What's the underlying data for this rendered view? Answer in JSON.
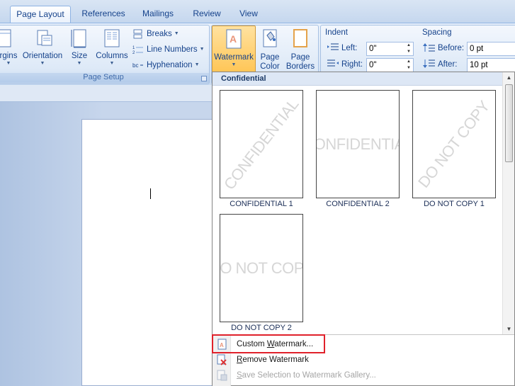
{
  "tabs": [
    {
      "label": "Page Layout",
      "active": true
    },
    {
      "label": "References",
      "active": false
    },
    {
      "label": "Mailings",
      "active": false
    },
    {
      "label": "Review",
      "active": false
    },
    {
      "label": "View",
      "active": false
    }
  ],
  "ribbon": {
    "page_setup": {
      "label": "Page Setup",
      "margins": "rgins",
      "orientation": "Orientation",
      "size": "Size",
      "columns": "Columns",
      "breaks": "Breaks",
      "line_numbers": "Line Numbers",
      "hyphenation": "Hyphenation"
    },
    "page_background": {
      "watermark": "Watermark",
      "page_color_1": "Page",
      "page_color_2": "Color",
      "page_borders_1": "Page",
      "page_borders_2": "Borders"
    },
    "indent": {
      "label": "Indent",
      "left_label": "Left:",
      "left_value": "0\"",
      "right_label": "Right:",
      "right_value": "0\""
    },
    "spacing": {
      "label": "Spacing",
      "before_label": "Before:",
      "before_value": "0 pt",
      "after_label": "After:",
      "after_value": "10 pt"
    }
  },
  "gallery": {
    "header": "Confidential",
    "items": [
      {
        "caption": "CONFIDENTIAL 1",
        "watermark": "CONFIDENTIAL",
        "style": "diagonal"
      },
      {
        "caption": "CONFIDENTIAL 2",
        "watermark": "CONFIDENTIAL",
        "style": "horizontal"
      },
      {
        "caption": "DO NOT COPY 1",
        "watermark": "DO NOT COPY",
        "style": "diagonal"
      },
      {
        "caption": "DO NOT COPY 2",
        "watermark": "DO NOT COPY",
        "style": "horizontal"
      }
    ],
    "menu": [
      {
        "pre": "Custom ",
        "accel": "W",
        "post": "atermark...",
        "enabled": true,
        "icon": "custom-watermark-icon"
      },
      {
        "pre": "",
        "accel": "R",
        "post": "emove Watermark",
        "enabled": true,
        "icon": "remove-watermark-icon"
      },
      {
        "pre": "",
        "accel": "S",
        "post": "ave Selection to Watermark Gallery...",
        "enabled": false,
        "icon": "save-selection-icon"
      }
    ]
  },
  "colors": {
    "highlight": "#e0212b",
    "ribbon_text": "#15428b"
  }
}
